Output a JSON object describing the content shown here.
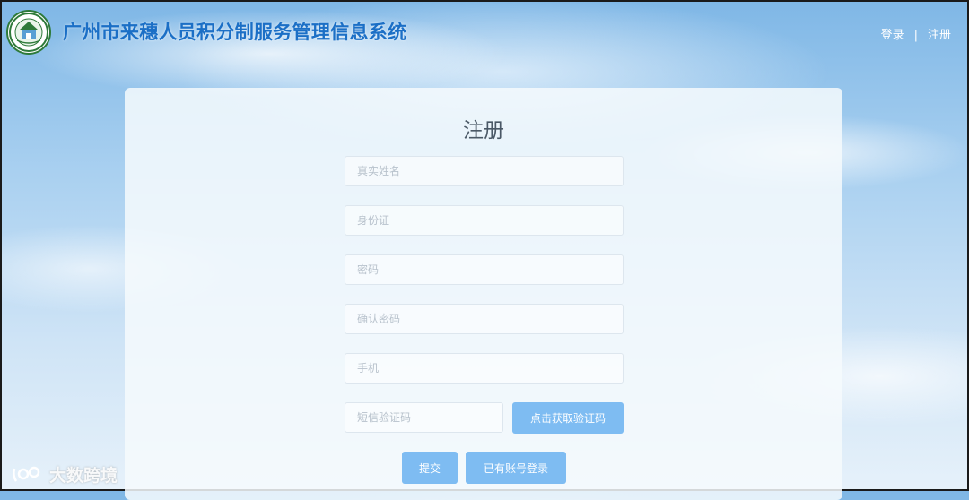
{
  "header": {
    "title": "广州市来穗人员积分制服务管理信息系统",
    "logo_icon": "government-seal-logo",
    "login_link": "登录",
    "separator": "|",
    "register_link": "注册"
  },
  "form": {
    "title": "注册",
    "fields": {
      "real_name": {
        "placeholder": "真实姓名",
        "value": ""
      },
      "id_card": {
        "placeholder": "身份证",
        "value": ""
      },
      "password": {
        "placeholder": "密码",
        "value": ""
      },
      "confirm_password": {
        "placeholder": "确认密码",
        "value": ""
      },
      "phone": {
        "placeholder": "手机",
        "value": ""
      },
      "sms_code": {
        "placeholder": "短信验证码",
        "value": ""
      }
    },
    "get_code_button": "点击获取验证码",
    "submit_button": "提交",
    "have_account_button": "已有账号登录"
  },
  "watermark": {
    "text": "大数跨境",
    "icon": "brand-logo-icon"
  },
  "colors": {
    "title_blue": "#1b6fc6",
    "button_blue": "#7ebcf2",
    "sky_top": "#7fb7e6"
  }
}
